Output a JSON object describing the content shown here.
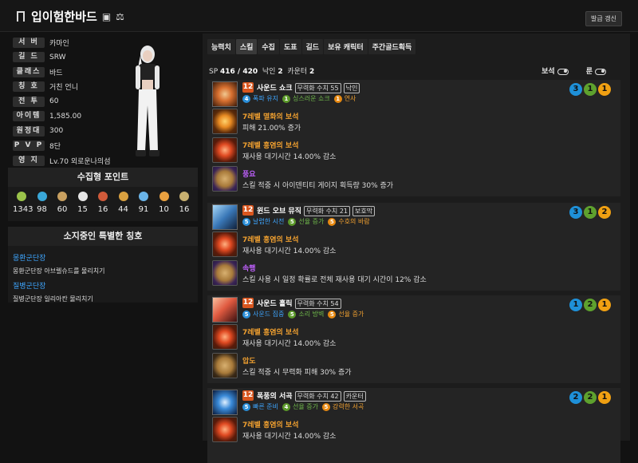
{
  "header": {
    "title": "입이험한바드",
    "refresh_label": "발급 갱신"
  },
  "profile": {
    "rows": [
      {
        "label": "서 버",
        "value": "카마인"
      },
      {
        "label": "길 드",
        "value": "SRW"
      },
      {
        "label": "클래스",
        "value": "바드"
      },
      {
        "label": "칭 호",
        "value": "거친 언니"
      },
      {
        "label": "전 투",
        "value": "60"
      },
      {
        "label": "아이템",
        "value": "1,585.00"
      },
      {
        "label": "원정대",
        "value": "300"
      },
      {
        "label": "P V P",
        "value": "8단"
      },
      {
        "label": "영 지",
        "value": "Lv.70 외로운나의섬"
      }
    ]
  },
  "collect": {
    "title": "수집형 포인트",
    "items": [
      {
        "icon": "seed-icon",
        "color": "#9bc34a",
        "value": "1343"
      },
      {
        "icon": "island-icon",
        "color": "#3aa7d8",
        "value": "98"
      },
      {
        "icon": "painting-icon",
        "color": "#c8a060",
        "value": "60"
      },
      {
        "icon": "heart-icon",
        "color": "#e6e6e6",
        "value": "15"
      },
      {
        "icon": "mask-icon",
        "color": "#d05a3a",
        "value": "16"
      },
      {
        "icon": "flute-icon",
        "color": "#d8a040",
        "value": "44"
      },
      {
        "icon": "star-icon",
        "color": "#6ab4e8",
        "value": "91"
      },
      {
        "icon": "sun-icon",
        "color": "#e8a040",
        "value": "10"
      },
      {
        "icon": "medal-icon",
        "color": "#c8b070",
        "value": "16"
      }
    ]
  },
  "titles": {
    "title": "소지중인 특별한 칭호",
    "items": [
      {
        "name": "몽환군단장",
        "desc": "몽환군단장 아브렐슈드를 물리치기"
      },
      {
        "name": "질병군단장",
        "desc": "질병군단장 일리아칸 물리치기"
      }
    ]
  },
  "tabs": [
    "능력치",
    "스킬",
    "수집",
    "도표",
    "길드",
    "보유 캐릭터",
    "주간골드획득"
  ],
  "active_tab": "스킬",
  "sp": {
    "label": "SP",
    "value": "416 / 420",
    "nakin_label": "낙인",
    "nakin": "2",
    "counter_label": "카운터",
    "counter": "2"
  },
  "toggles": {
    "gem": "보석",
    "rune": "룬"
  },
  "skills": [
    {
      "level": "12",
      "name": "사운드 쇼크",
      "badges": [
        "무력화 수치 55",
        "낙인"
      ],
      "tripods": [
        {
          "n": "4",
          "t": "폭파 유지",
          "c": "c1"
        },
        {
          "n": "1",
          "t": "싱스러운 쇼크",
          "c": "c2"
        },
        {
          "n": "1",
          "t": "연사",
          "c": "c3"
        }
      ],
      "circles": [
        {
          "n": "3",
          "c": "b"
        },
        {
          "n": "1",
          "c": "g"
        },
        {
          "n": "1",
          "c": "o"
        }
      ],
      "items": [
        {
          "name": "7레벨 멸화의 보석",
          "desc": "피해 21.00% 증가",
          "cls": "orange",
          "icon": "gem-o"
        },
        {
          "name": "7레벨 홍염의 보석",
          "desc": "재사용 대기시간 14.00% 감소",
          "cls": "orange",
          "icon": "gem-r"
        },
        {
          "name": "풍요",
          "desc": "스킬 적중 시 아이덴티티 게이지 획득량 30% 증가",
          "cls": "purple",
          "icon": "rune-p"
        }
      ]
    },
    {
      "level": "12",
      "name": "윈드 오브 뮤직",
      "badges": [
        "무력화 수치 21",
        "보호막"
      ],
      "tripods": [
        {
          "n": "5",
          "t": "날렵한 시전",
          "c": "c1"
        },
        {
          "n": "5",
          "t": "선율 증가",
          "c": "c2"
        },
        {
          "n": "5",
          "t": "수호의 바람",
          "c": "c3"
        }
      ],
      "circles": [
        {
          "n": "3",
          "c": "b"
        },
        {
          "n": "1",
          "c": "g"
        },
        {
          "n": "2",
          "c": "o"
        }
      ],
      "items": [
        {
          "name": "7레벨 홍염의 보석",
          "desc": "재사용 대기시간 14.00% 감소",
          "cls": "orange",
          "icon": "gem-r"
        },
        {
          "name": "속행",
          "desc": "스킬 사용 시 일정 확률로 전체 재사용 대기 시간이 12% 감소",
          "cls": "purple",
          "icon": "rune-p"
        }
      ]
    },
    {
      "level": "12",
      "name": "사운드 홀릭",
      "badges": [
        "무력화 수치 54"
      ],
      "tripods": [
        {
          "n": "5",
          "t": "사운드 집중",
          "c": "c1"
        },
        {
          "n": "5",
          "t": "소리 방벽",
          "c": "c2"
        },
        {
          "n": "5",
          "t": "선율 증가",
          "c": "c3"
        }
      ],
      "circles": [
        {
          "n": "1",
          "c": "b"
        },
        {
          "n": "2",
          "c": "g"
        },
        {
          "n": "1",
          "c": "o"
        }
      ],
      "items": [
        {
          "name": "7레벨 홍염의 보석",
          "desc": "재사용 대기시간 14.00% 감소",
          "cls": "orange",
          "icon": "gem-r"
        },
        {
          "name": "압도",
          "desc": "스킬 적중 시 무력화 피해 30% 증가",
          "cls": "orange",
          "icon": "rune-o"
        }
      ]
    },
    {
      "level": "12",
      "name": "폭풍의 서곡",
      "badges": [
        "무력화 수치 42",
        "카운터"
      ],
      "tripods": [
        {
          "n": "5",
          "t": "빠른 준비",
          "c": "c1"
        },
        {
          "n": "4",
          "t": "선율 증가",
          "c": "c2"
        },
        {
          "n": "5",
          "t": "강력한 서곡",
          "c": "c3"
        }
      ],
      "circles": [
        {
          "n": "2",
          "c": "b"
        },
        {
          "n": "2",
          "c": "g"
        },
        {
          "n": "1",
          "c": "o"
        }
      ],
      "items": [
        {
          "name": "7레벨 홍염의 보석",
          "desc": "재사용 대기시간 14.00% 감소",
          "cls": "orange",
          "icon": "gem-r"
        }
      ]
    }
  ]
}
